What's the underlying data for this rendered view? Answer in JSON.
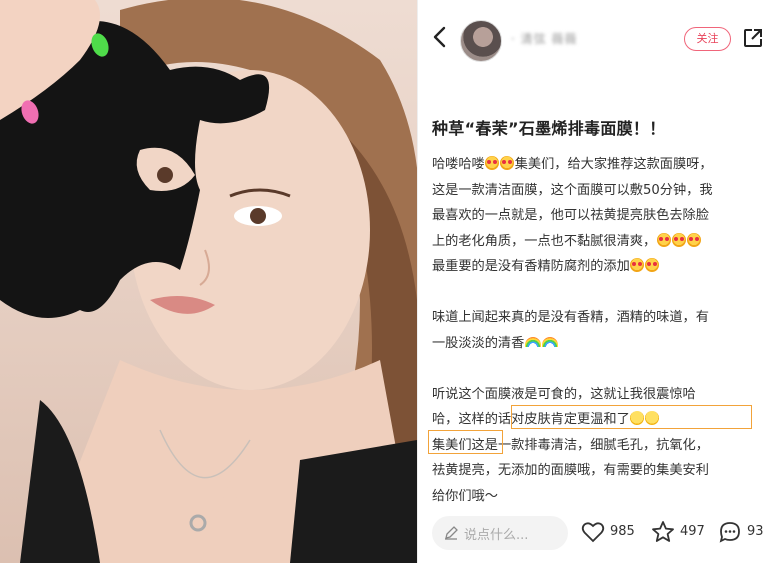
{
  "header": {
    "username": "· 清弦 薇薇",
    "follow_label": "关注"
  },
  "post": {
    "title": "种草“春茉”石墨烯排毒面膜！！",
    "lines": [
      "哈喽哈喽",
      "集美们，给大家推荐这款面膜呀，",
      "这是一款清洁面膜，这个面膜可以敷50分钟，我",
      "最喜欢的一点就是，他可以祛黄提亮肤色去除脸",
      "上的老化角质，一点也不黏腻很清爽，",
      "最重要的是没有香精防腐剂的添加",
      "味道上闻起来真的是没有香精，酒精的味道，有",
      "一股淡淡的清香",
      "听说这个面膜液是可食的，这就让我很震惊哈",
      "哈，这样的话对皮肤肯定更温和了",
      "集美们这是",
      "一款排毒清洁，细腻毛孔，抗氧化，",
      "祛黄提亮",
      "，无添加的面膜哦，有需要的集美安利",
      "给你们哦～"
    ]
  },
  "bottom": {
    "comment_placeholder": "说点什么...",
    "likes": "985",
    "stars": "497",
    "comments": "93"
  },
  "colors": {
    "accent": "#e8435a",
    "highlight": "#f2a33a"
  },
  "icons": [
    "back-icon",
    "share-icon",
    "pen-icon",
    "heart-icon",
    "star-icon",
    "comment-icon"
  ]
}
